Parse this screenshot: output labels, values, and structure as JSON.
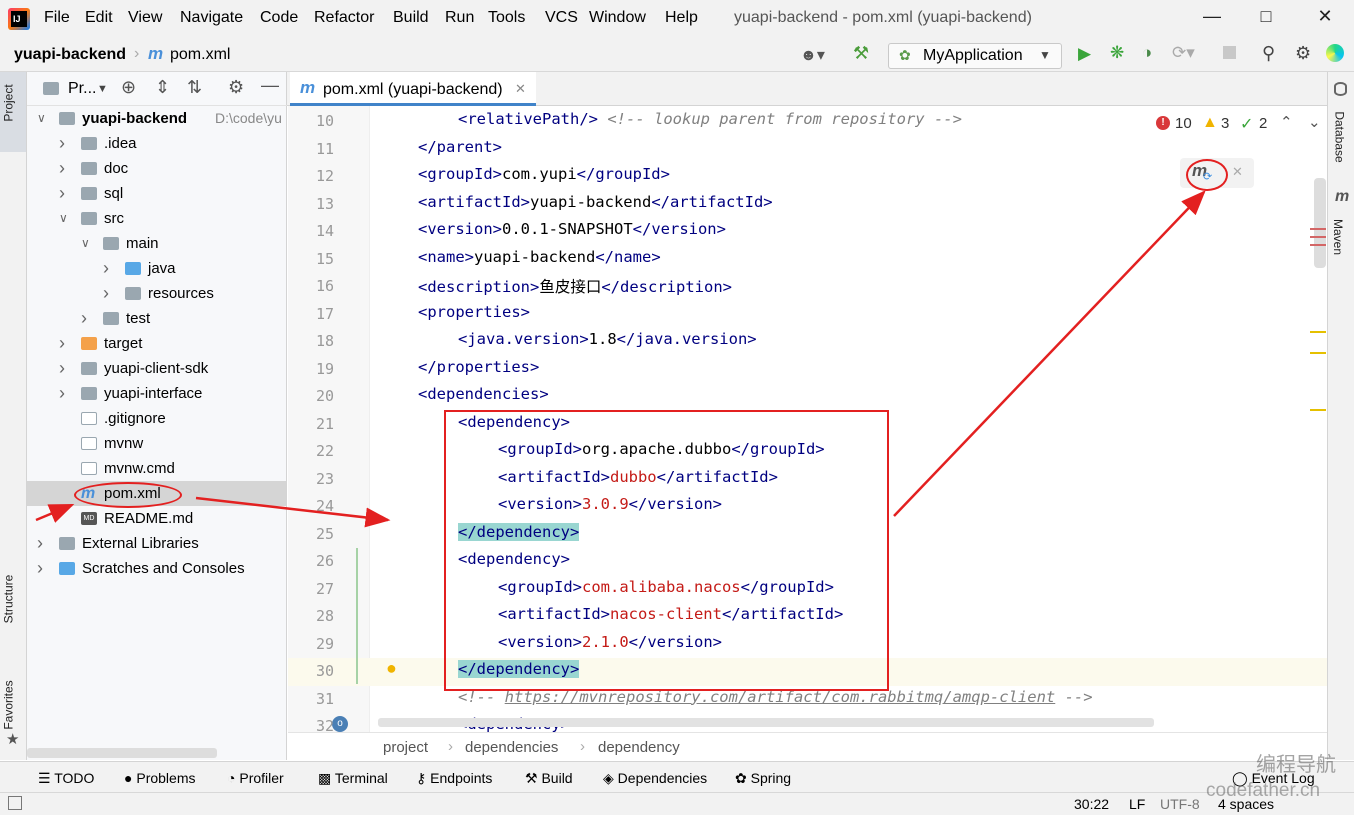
{
  "menubar": {
    "logo_text": "IJ",
    "items": [
      "File",
      "Edit",
      "View",
      "Navigate",
      "Code",
      "Refactor",
      "Build",
      "Run",
      "Tools",
      "VCS",
      "Window",
      "Help"
    ],
    "window_title": "yuapi-backend - pom.xml (yuapi-backend)"
  },
  "navbar": {
    "project": "yuapi-backend",
    "file": "pom.xml",
    "run_config": "MyApplication"
  },
  "side": {
    "project_label": "Project",
    "structure_label": "Structure",
    "favorites_label": "Favorites",
    "database_label": "Database",
    "maven_label": "Maven"
  },
  "project_panel": {
    "title": "Pr...",
    "tree": [
      {
        "label": "yuapi-backend",
        "extra": "D:\\code\\yu",
        "level": 0,
        "expanded": true,
        "icon": "module-folder"
      },
      {
        "label": ".idea",
        "level": 1,
        "expanded": false,
        "icon": "folder"
      },
      {
        "label": "doc",
        "level": 1,
        "expanded": false,
        "icon": "folder"
      },
      {
        "label": "sql",
        "level": 1,
        "expanded": false,
        "icon": "folder"
      },
      {
        "label": "src",
        "level": 1,
        "expanded": true,
        "icon": "folder"
      },
      {
        "label": "main",
        "level": 2,
        "expanded": true,
        "icon": "folder"
      },
      {
        "label": "java",
        "level": 3,
        "expanded": false,
        "icon": "folder-blue"
      },
      {
        "label": "resources",
        "level": 3,
        "expanded": false,
        "icon": "folder-res"
      },
      {
        "label": "test",
        "level": 2,
        "expanded": false,
        "icon": "folder"
      },
      {
        "label": "target",
        "level": 1,
        "expanded": false,
        "icon": "folder-orange"
      },
      {
        "label": "yuapi-client-sdk",
        "level": 1,
        "expanded": false,
        "icon": "folder"
      },
      {
        "label": "yuapi-interface",
        "level": 1,
        "expanded": false,
        "icon": "folder"
      },
      {
        "label": ".gitignore",
        "level": 1,
        "icon": "file"
      },
      {
        "label": "mvnw",
        "level": 1,
        "icon": "file"
      },
      {
        "label": "mvnw.cmd",
        "level": 1,
        "icon": "file"
      },
      {
        "label": "pom.xml",
        "level": 1,
        "icon": "maven-file",
        "selected": true
      },
      {
        "label": "README.md",
        "level": 1,
        "icon": "md-file"
      },
      {
        "label": "External Libraries",
        "level": 0,
        "expanded": false,
        "icon": "library"
      },
      {
        "label": "Scratches and Consoles",
        "level": 0,
        "expanded": false,
        "icon": "scratch"
      }
    ]
  },
  "editor": {
    "tab_label": "pom.xml (yuapi-backend)",
    "inspections": {
      "errors": "10",
      "warnings": "3",
      "ok": "2"
    },
    "lines": [
      {
        "n": "10",
        "indent": 2,
        "parts": [
          [
            "tag",
            "<relativePath/>"
          ],
          [
            "val",
            " "
          ],
          [
            "cmt",
            "<!-- lookup parent from repository -->"
          ]
        ]
      },
      {
        "n": "11",
        "indent": 1,
        "parts": [
          [
            "tag",
            "</parent>"
          ]
        ]
      },
      {
        "n": "12",
        "indent": 1,
        "parts": [
          [
            "tag",
            "<groupId>"
          ],
          [
            "val",
            "com.yupi"
          ],
          [
            "tag",
            "</groupId>"
          ]
        ]
      },
      {
        "n": "13",
        "indent": 1,
        "parts": [
          [
            "tag",
            "<artifactId>"
          ],
          [
            "val",
            "yuapi-backend"
          ],
          [
            "tag",
            "</artifactId>"
          ]
        ]
      },
      {
        "n": "14",
        "indent": 1,
        "parts": [
          [
            "tag",
            "<version>"
          ],
          [
            "val",
            "0.0.1-SNAPSHOT"
          ],
          [
            "tag",
            "</version>"
          ]
        ]
      },
      {
        "n": "15",
        "indent": 1,
        "parts": [
          [
            "tag",
            "<name>"
          ],
          [
            "val",
            "yuapi-backend"
          ],
          [
            "tag",
            "</name>"
          ]
        ]
      },
      {
        "n": "16",
        "indent": 1,
        "parts": [
          [
            "tag",
            "<description>"
          ],
          [
            "val",
            "鱼皮接口"
          ],
          [
            "tag",
            "</description>"
          ]
        ]
      },
      {
        "n": "17",
        "indent": 1,
        "parts": [
          [
            "tag",
            "<properties>"
          ]
        ]
      },
      {
        "n": "18",
        "indent": 2,
        "parts": [
          [
            "tag",
            "<java.version>"
          ],
          [
            "val",
            "1.8"
          ],
          [
            "tag",
            "</java.version>"
          ]
        ]
      },
      {
        "n": "19",
        "indent": 1,
        "parts": [
          [
            "tag",
            "</properties>"
          ]
        ]
      },
      {
        "n": "20",
        "indent": 1,
        "parts": [
          [
            "tag",
            "<dependencies>"
          ]
        ]
      },
      {
        "n": "21",
        "indent": 2,
        "parts": [
          [
            "tag",
            "<dependency>"
          ]
        ]
      },
      {
        "n": "22",
        "indent": 3,
        "parts": [
          [
            "tag",
            "<groupId>"
          ],
          [
            "val",
            "org.apache.dubbo"
          ],
          [
            "tag",
            "</groupId>"
          ]
        ]
      },
      {
        "n": "23",
        "indent": 3,
        "parts": [
          [
            "tag",
            "<artifactId>"
          ],
          [
            "str",
            "dubbo"
          ],
          [
            "tag",
            "</artifactId>"
          ]
        ]
      },
      {
        "n": "24",
        "indent": 3,
        "parts": [
          [
            "tag",
            "<version>"
          ],
          [
            "str",
            "3.0.9"
          ],
          [
            "tag",
            "</version>"
          ]
        ]
      },
      {
        "n": "25",
        "indent": 2,
        "parts": [
          [
            "tag",
            "</dependency>"
          ]
        ]
      },
      {
        "n": "26",
        "indent": 2,
        "parts": [
          [
            "tag",
            "<dependency>"
          ]
        ]
      },
      {
        "n": "27",
        "indent": 3,
        "parts": [
          [
            "tag",
            "<groupId>"
          ],
          [
            "str",
            "com.alibaba.nacos"
          ],
          [
            "tag",
            "</groupId>"
          ]
        ]
      },
      {
        "n": "28",
        "indent": 3,
        "parts": [
          [
            "tag",
            "<artifactId>"
          ],
          [
            "str",
            "nacos-client"
          ],
          [
            "tag",
            "</artifactId>"
          ]
        ]
      },
      {
        "n": "29",
        "indent": 3,
        "parts": [
          [
            "tag",
            "<version>"
          ],
          [
            "str",
            "2.1.0"
          ],
          [
            "tag",
            "</version>"
          ]
        ]
      },
      {
        "n": "30",
        "indent": 2,
        "parts": [
          [
            "tag",
            "</dependency>"
          ]
        ]
      },
      {
        "n": "31",
        "indent": 2,
        "parts": [
          [
            "cmt",
            "<!-- "
          ],
          [
            "lnk",
            "https://mvnrepository.com/artifact/com.rabbitmq/amqp-client"
          ],
          [
            "cmt",
            " -->"
          ]
        ]
      },
      {
        "n": "32",
        "indent": 2,
        "parts": [
          [
            "tag",
            "<dependency>"
          ]
        ]
      }
    ]
  },
  "breadcrumb": [
    "project",
    "dependencies",
    "dependency"
  ],
  "bottom_tools": [
    "TODO",
    "Problems",
    "Profiler",
    "Terminal",
    "Endpoints",
    "Build",
    "Dependencies",
    "Spring"
  ],
  "event_log": "Event Log",
  "status": {
    "position": "30:22",
    "line_sep": "LF",
    "encoding": "UTF-8",
    "indent": "4 spaces"
  },
  "watermark": {
    "line1": "编程导航",
    "line2": "codefather.cn"
  },
  "colors": {
    "annotation": "#e32020",
    "accent": "#4083c9"
  }
}
